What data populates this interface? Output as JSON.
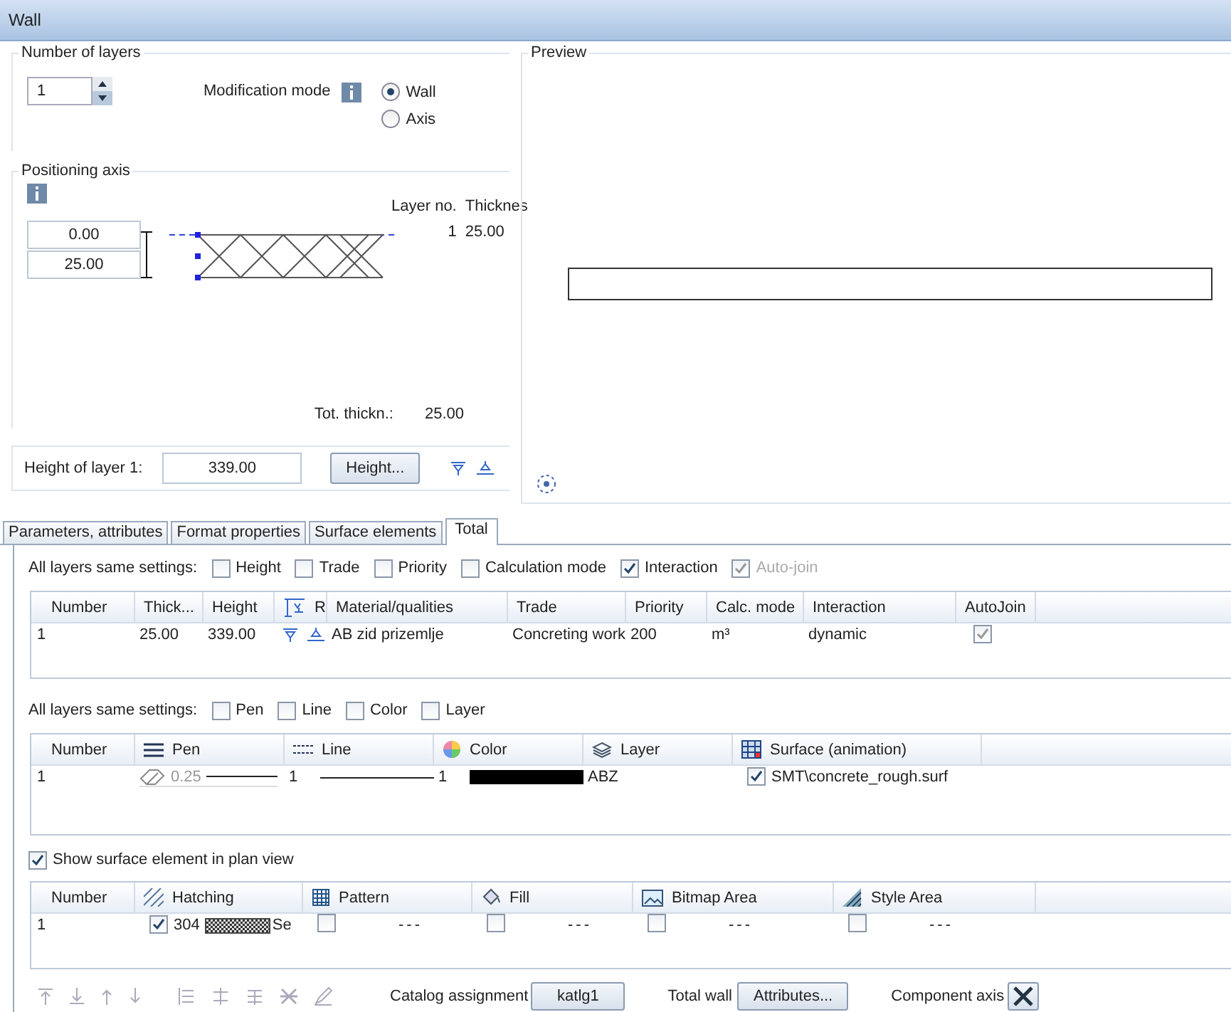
{
  "window": {
    "title": "Wall"
  },
  "layers": {
    "title": "Number of layers",
    "value": "1"
  },
  "modification_mode": {
    "label": "Modification mode",
    "options": [
      {
        "label": "Wall",
        "selected": true
      },
      {
        "label": "Axis",
        "selected": false
      }
    ]
  },
  "positioning": {
    "title": "Positioning axis",
    "offsets": [
      "0.00",
      "25.00"
    ],
    "columns": [
      "Layer no.",
      "Thicknes"
    ],
    "rows": [
      {
        "number": "1",
        "thickness": "25.00"
      }
    ],
    "total_label": "Tot. thickn.:",
    "total_value": "25.00"
  },
  "height": {
    "label": "Height of layer 1:",
    "value": "339.00",
    "button": "Height..."
  },
  "preview": {
    "title": "Preview"
  },
  "tabs": [
    {
      "label": "Parameters, attributes",
      "selected": false
    },
    {
      "label": "Format properties",
      "selected": false
    },
    {
      "label": "Surface elements",
      "selected": false
    },
    {
      "label": "Total",
      "selected": true
    }
  ],
  "layer_settings": {
    "label": "All layers same settings:",
    "options": [
      {
        "label": "Height",
        "checked": false,
        "disabled": false
      },
      {
        "label": "Trade",
        "checked": false,
        "disabled": false
      },
      {
        "label": "Priority",
        "checked": false,
        "disabled": false
      },
      {
        "label": "Calculation mode",
        "checked": false,
        "disabled": false
      },
      {
        "label": "Interaction",
        "checked": true,
        "disabled": false
      },
      {
        "label": "Auto-join",
        "checked": true,
        "disabled": true
      }
    ]
  },
  "layers_table": {
    "columns": [
      "Number",
      "Thick...",
      "Height",
      "R",
      "Material/qualities",
      "Trade",
      "Priority",
      "Calc. mode",
      "Interaction",
      "AutoJoin"
    ],
    "rows": [
      {
        "cells": [
          {
            "kind": "text",
            "text": "1"
          },
          {
            "kind": "text",
            "text": "25.00"
          },
          {
            "kind": "text",
            "text": "339.00"
          },
          {
            "kind": "icons"
          },
          {
            "kind": "text",
            "text": "AB zid prizemlje"
          },
          {
            "kind": "text",
            "text": "Concreting work"
          },
          {
            "kind": "text",
            "text": "200"
          },
          {
            "kind": "text",
            "text": "m³"
          },
          {
            "kind": "text",
            "text": "dynamic"
          },
          {
            "kind": "check",
            "checked": true
          }
        ]
      }
    ]
  },
  "format_settings": {
    "label": "All layers same settings:",
    "options": [
      {
        "label": "Pen",
        "checked": false,
        "disabled": false
      },
      {
        "label": "Line",
        "checked": false,
        "disabled": false
      },
      {
        "label": "Color",
        "checked": false,
        "disabled": false
      },
      {
        "label": "Layer",
        "checked": false,
        "disabled": false
      }
    ]
  },
  "format_table": {
    "columns": [
      "Number",
      "Pen",
      "Line",
      "Color",
      "Layer",
      "Surface (animation)"
    ],
    "rows": [
      {
        "cells": [
          {
            "kind": "text",
            "text": "1"
          },
          {
            "kind": "pen",
            "text": "0.25"
          },
          {
            "kind": "line",
            "text": "1"
          },
          {
            "kind": "color",
            "text": "1",
            "color": "#000000"
          },
          {
            "kind": "text",
            "text": "ABZ"
          },
          {
            "kind": "check_text",
            "checked": true,
            "text": "SMT\\concrete_rough.surf"
          }
        ]
      }
    ]
  },
  "show_surface": {
    "label": "Show surface element in plan view",
    "checked": true
  },
  "surface_table": {
    "columns": [
      "Number",
      "Hatching",
      "Pattern",
      "Fill",
      "Bitmap Area",
      "Style Area"
    ],
    "rows": [
      {
        "cells": [
          {
            "kind": "text",
            "text": "1"
          },
          {
            "kind": "hatch",
            "checked": true,
            "text": "304",
            "suffix": "Se"
          },
          {
            "kind": "check_text",
            "checked": false,
            "text": "---"
          },
          {
            "kind": "check_text",
            "checked": false,
            "text": "---"
          },
          {
            "kind": "check_text",
            "checked": false,
            "text": "---"
          },
          {
            "kind": "check_text",
            "checked": false,
            "text": "---"
          }
        ]
      }
    ]
  },
  "footer": {
    "catalog_label": "Catalog assignment",
    "catalog_button": "katlg1",
    "total_label": "Total wall",
    "attributes_button": "Attributes...",
    "axis_label": "Component axis"
  }
}
